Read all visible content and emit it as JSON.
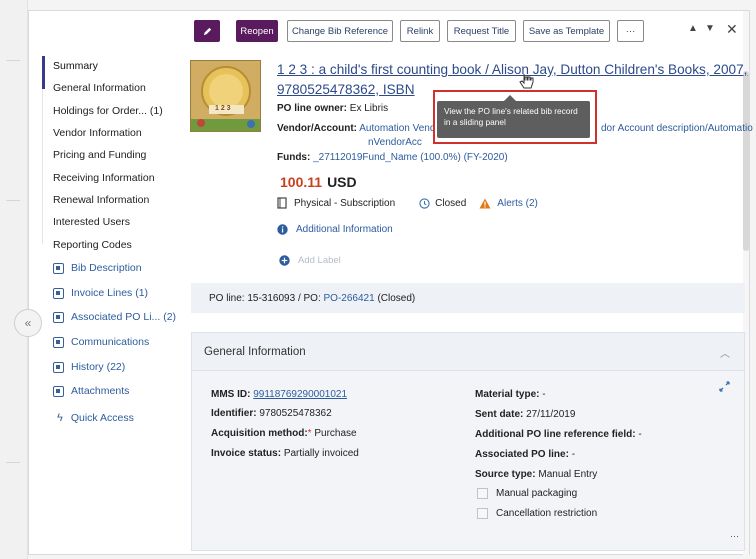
{
  "toolbar": {
    "reopen": "Reopen",
    "change_bib": "Change Bib Reference",
    "relink": "Relink",
    "request_title": "Request Title",
    "save_template": "Save as Template",
    "more": "···",
    "up": "▲",
    "down": "▼",
    "close": "✕"
  },
  "nav": {
    "items": [
      "Summary",
      "General Information",
      "Holdings for Order... (1)",
      "Vendor Information",
      "Pricing and Funding",
      "Receiving Information",
      "Renewal Information",
      "Interested Users",
      "Reporting Codes"
    ],
    "sections": [
      "Bib Description",
      "Invoice Lines (1)",
      "Associated PO Li... (2)",
      "Communications",
      "History (22)",
      "Attachments"
    ],
    "quick_access": "Quick Access"
  },
  "record": {
    "cover_text": "1 2 3",
    "title_line1": "1 2 3 : a child's first counting book / Alison Jay, Dutton Children's Books, 2007,",
    "title_line2": "9780525478362, ISBN",
    "owner_label": "PO line owner:",
    "owner_value": "Ex Libris",
    "vendor_label": "Vendor/Account:",
    "vendor_value1": "Automation Vend",
    "vendor_value_end": "dor Account description/Automatio",
    "vendor_value2": "nVendorAcc",
    "funds_label": "Funds:",
    "funds_value": "_27112019Fund_Name (100.0%) (FY-2020)",
    "price": "100.11",
    "currency": "USD",
    "format": "Physical - Subscription",
    "status": "Closed",
    "alerts": "Alerts (2)",
    "additional": "Additional Information",
    "add_label": "Add Label",
    "tooltip": "View the PO line's related bib record in a sliding panel"
  },
  "poline": {
    "label": "PO line: 15-316093 / PO:",
    "po_link": "PO-266421",
    "suffix": "(Closed)"
  },
  "general": {
    "header": "General Information",
    "mms_label": "MMS ID:",
    "mms_value": "99118769290001021",
    "identifier_label": "Identifier:",
    "identifier_value": "9780525478362",
    "acq_label": "Acquisition method:",
    "acq_req": "*",
    "acq_value": "Purchase",
    "invoice_label": "Invoice status:",
    "invoice_value": "Partially invoiced",
    "material_label": "Material type:",
    "material_value": "-",
    "sent_label": "Sent date:",
    "sent_value": "27/11/2019",
    "addref_label": "Additional PO line reference field:",
    "addref_value": "-",
    "assoc_label": "Associated PO line:",
    "assoc_value": "-",
    "source_label": "Source type:",
    "source_value": "Manual Entry",
    "manual_packaging": "Manual packaging",
    "cancel_restriction": "Cancellation restriction"
  }
}
